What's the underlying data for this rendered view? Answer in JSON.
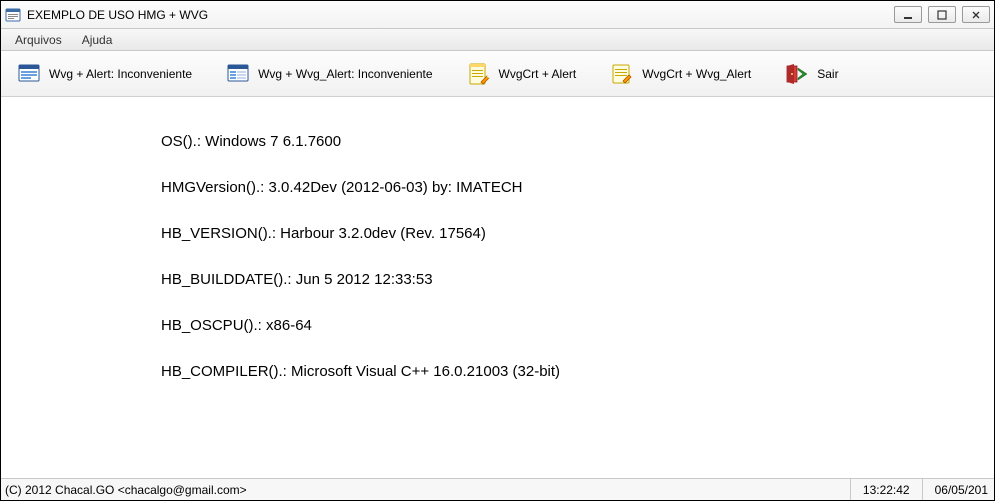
{
  "window": {
    "title": "EXEMPLO DE USO HMG + WVG"
  },
  "menubar": {
    "items": [
      "Arquivos",
      "Ajuda"
    ]
  },
  "toolbar": {
    "btn1": {
      "label": "Wvg + Alert: Inconveniente"
    },
    "btn2": {
      "label": "Wvg + Wvg_Alert: Inconveniente"
    },
    "btn3": {
      "label": "WvgCrt + Alert"
    },
    "btn4": {
      "label": "WvgCrt + Wvg_Alert"
    },
    "btn5": {
      "label": "Sair"
    }
  },
  "content": {
    "lines": [
      "OS().: Windows 7 6.1.7600",
      "HMGVersion().: 3.0.42Dev (2012-06-03) by: IMATECH",
      "HB_VERSION().: Harbour 3.2.0dev (Rev. 17564)",
      "HB_BUILDDATE().: Jun  5 2012 12:33:53",
      "HB_OSCPU().: x86-64",
      "HB_COMPILER().: Microsoft Visual C++ 16.0.21003 (32-bit)"
    ]
  },
  "statusbar": {
    "copyright": "(C) 2012 Chacal.GO <chacalgo@gmail.com>",
    "time": "13:22:42",
    "date": "06/05/201"
  }
}
